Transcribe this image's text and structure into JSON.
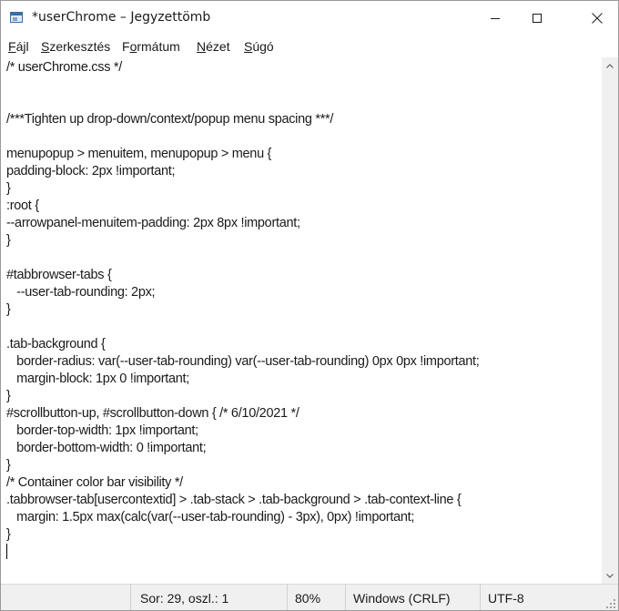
{
  "window": {
    "title": "*userChrome – Jegyzettömb",
    "app_icon": "notepad-icon",
    "controls": [
      "minimize-icon",
      "maximize-icon",
      "close-icon"
    ]
  },
  "menubar": {
    "items": [
      {
        "accel": "F",
        "rest": "ájl"
      },
      {
        "accel": "S",
        "rest": "zerkesztés"
      },
      {
        "accel": "F",
        "rest": "ormátum",
        "accel_pos": "middle",
        "before": "F",
        "accel_mid": "o",
        "after": "rmátum"
      },
      {
        "accel": "N",
        "rest": "ézet"
      },
      {
        "accel": "S",
        "rest": "úgó"
      }
    ]
  },
  "editor": {
    "text": "/* userChrome.css */\n\n\n/***Tighten up drop-down/context/popup menu spacing ***/\n\nmenupopup > menuitem, menupopup > menu {\npadding-block: 2px !important;\n}\n:root {\n--arrowpanel-menuitem-padding: 2px 8px !important;\n}\n\n#tabbrowser-tabs {\n   --user-tab-rounding: 2px;\n}\n\n.tab-background {\n   border-radius: var(--user-tab-rounding) var(--user-tab-rounding) 0px 0px !important;\n   margin-block: 1px 0 !important;\n}\n#scrollbutton-up, #scrollbutton-down { /* 6/10/2021 */\n   border-top-width: 1px !important;\n   border-bottom-width: 0 !important;\n}\n/* Container color bar visibility */\n.tabbrowser-tab[usercontextid] > .tab-stack > .tab-background > .tab-context-line {\n   margin: 1.5px max(calc(var(--user-tab-rounding) - 3px), 0px) !important;\n}\n"
  },
  "statusbar": {
    "position": "Sor: 29, oszl.: 1",
    "zoom": "80%",
    "line_ending": "Windows (CRLF)",
    "encoding": "UTF-8"
  }
}
